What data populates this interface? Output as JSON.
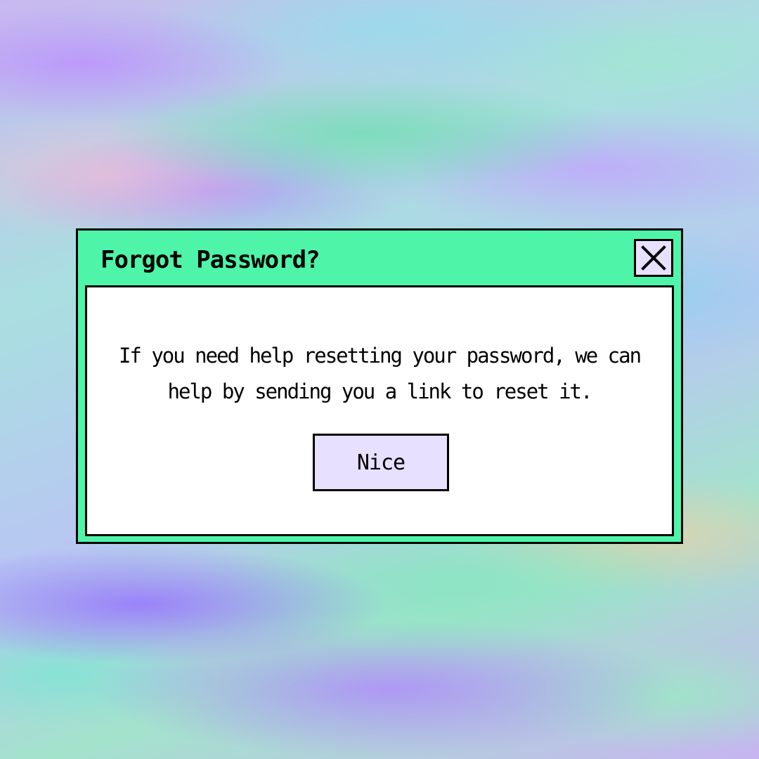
{
  "background": {
    "style": "holographic iridescent",
    "colors": [
      "#c9b8f0",
      "#a9dfe0",
      "#a3e3cc",
      "#b98cff",
      "#ffbed2"
    ]
  },
  "dialog": {
    "title": "Forgot Password?",
    "message": "If you need help resetting your password, we can help by sending you a link to reset it.",
    "close_icon": "close-icon",
    "ok_label": "Nice",
    "colors": {
      "frame": "#4ef5a8",
      "border": "#000000",
      "content_bg": "#ffffff",
      "button_bg": "#e8e0ff"
    }
  }
}
